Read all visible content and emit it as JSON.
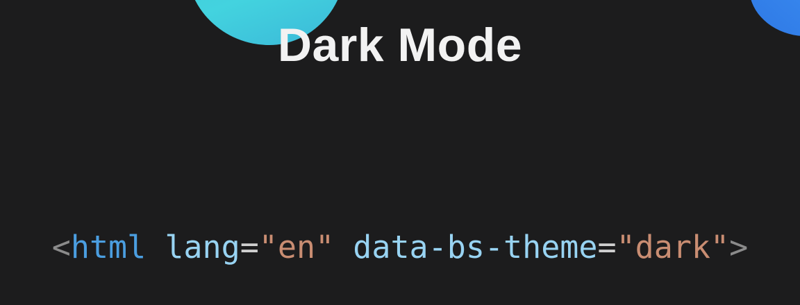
{
  "title": "Dark Mode",
  "code": {
    "open_bracket": "<",
    "tag": "html",
    "attr1_name": "lang",
    "attr1_eq": "=",
    "attr1_value": "\"en\"",
    "attr2_name": "data-bs-theme",
    "attr2_eq": "=",
    "attr2_value": "\"dark\"",
    "close_bracket": ">"
  },
  "colors": {
    "background": "#1c1c1d",
    "title": "#f2f2f2",
    "tag": "#4b9ee0",
    "attribute": "#98d3f2",
    "string": "#c98d72",
    "punctuation": "#8b8b8b",
    "blob_cyan": "#43d3df",
    "blob_blue": "#3d8ff2"
  }
}
